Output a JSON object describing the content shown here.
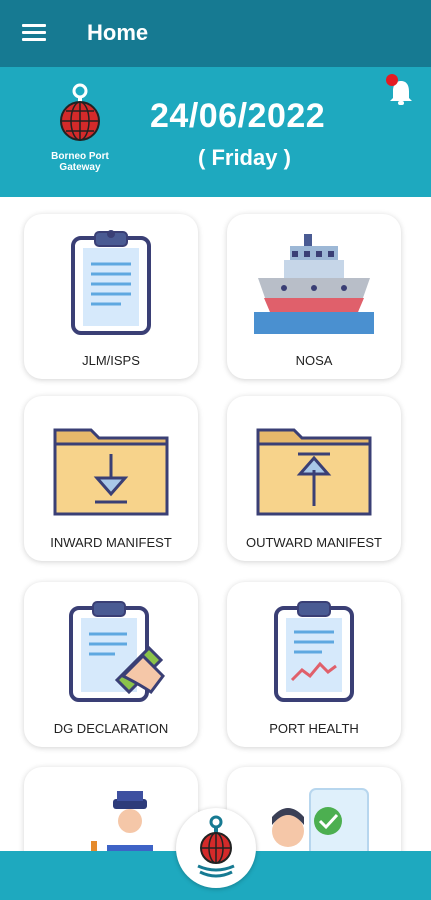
{
  "appbar": {
    "title": "Home",
    "menu_icon": "hamburger-menu-icon"
  },
  "header": {
    "logo_text_line1": "Borneo Port",
    "logo_text_line2": "Gateway",
    "date": "24/06/2022",
    "day": "( Friday )",
    "notification_icon": "bell-icon",
    "has_notification": true
  },
  "tiles": [
    {
      "label": "JLM/ISPS",
      "icon": "clipboard-icon"
    },
    {
      "label": "NOSA",
      "icon": "ship-icon"
    },
    {
      "label": "INWARD MANIFEST",
      "icon": "folder-download-icon"
    },
    {
      "label": "OUTWARD MANIFEST",
      "icon": "folder-upload-icon"
    },
    {
      "label": "DG DECLARATION",
      "icon": "clipboard-edit-icon"
    },
    {
      "label": "PORT HEALTH",
      "icon": "clipboard-chart-icon"
    },
    {
      "label": "",
      "icon": "officer-icon"
    },
    {
      "label": "",
      "icon": "approval-checklist-icon"
    }
  ],
  "colors": {
    "appbar": "#167a92",
    "header": "#1ea9bf",
    "bottom_bar": "#1ea9bf",
    "notification_dot": "#e31b23"
  },
  "bottom_nav": {
    "center_button_icon": "port-logo-icon"
  }
}
